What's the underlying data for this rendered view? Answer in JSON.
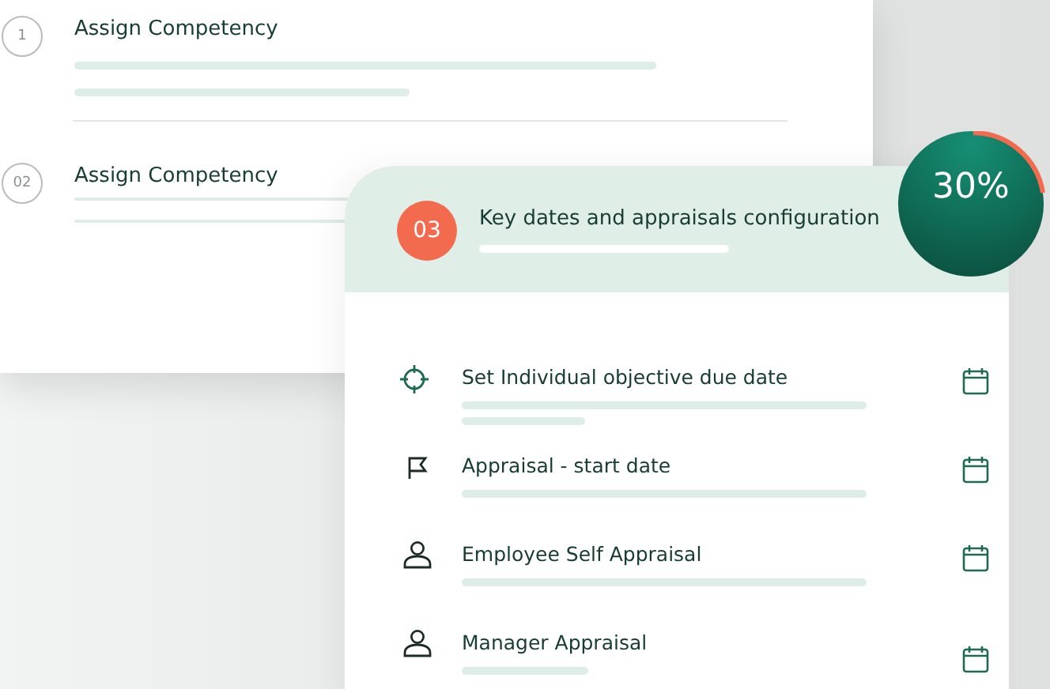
{
  "steps": [
    {
      "number": "1",
      "title": "Assign Competency"
    },
    {
      "number": "02",
      "title": "Assign Competency"
    }
  ],
  "active_step": {
    "number": "03",
    "title": "Key dates and appraisals configuration",
    "progress": "30%"
  },
  "dates": [
    {
      "label": "Set Individual objective due date",
      "kind": "target"
    },
    {
      "label": "Appraisal - start date",
      "kind": "flag"
    },
    {
      "label": "Employee Self Appraisal",
      "kind": "person"
    },
    {
      "label": "Manager Appraisal",
      "kind": "person"
    }
  ]
}
